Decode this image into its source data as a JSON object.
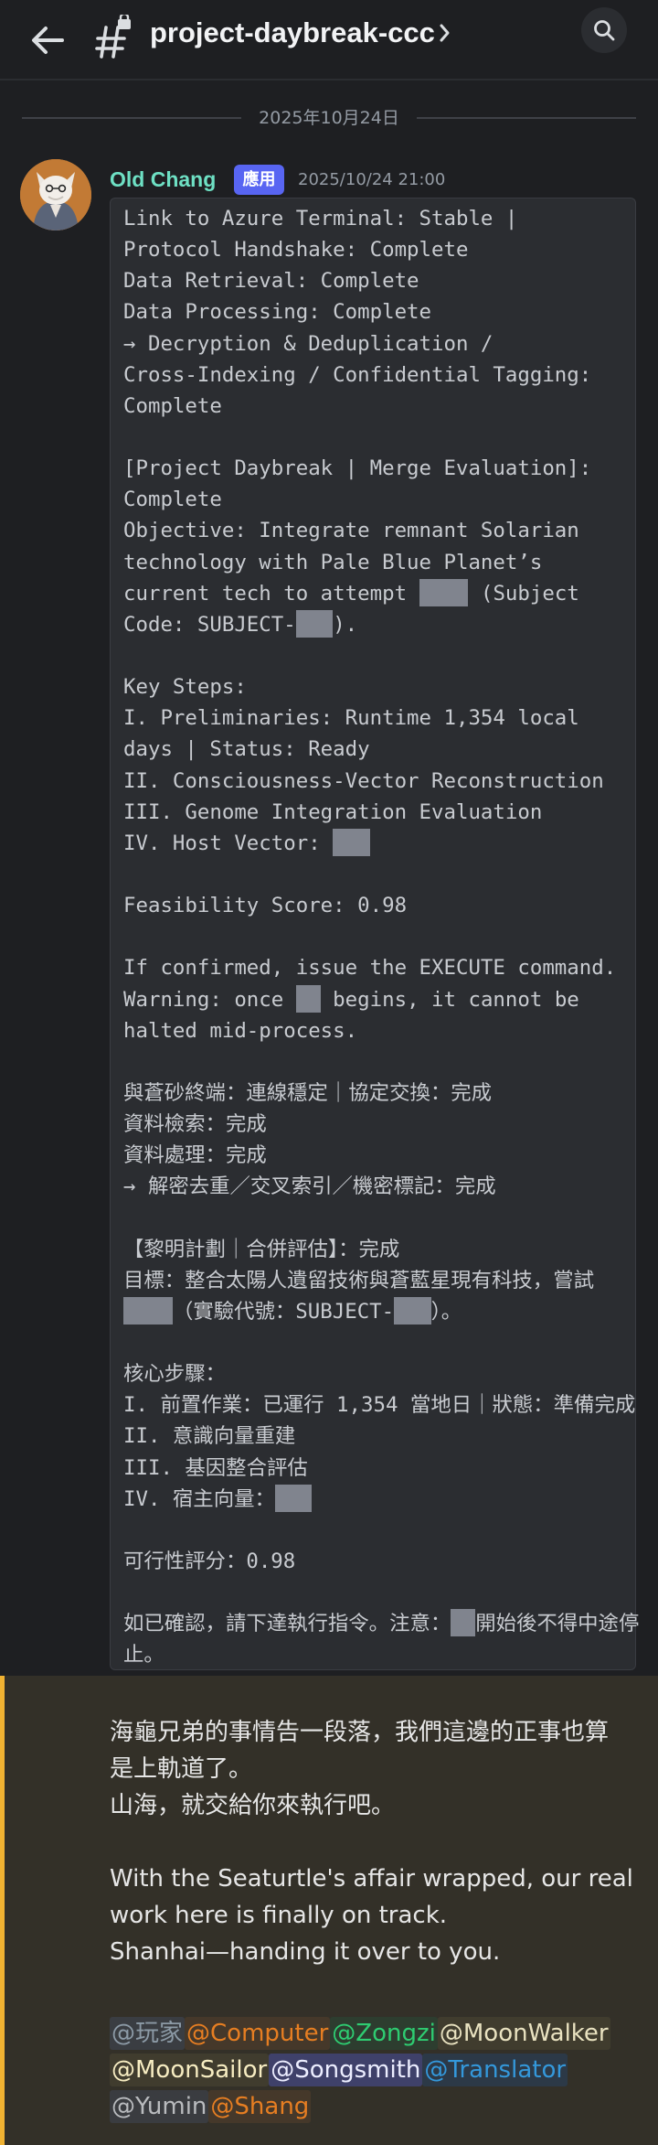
{
  "header": {
    "channel_name": "project-daybreak-ccc",
    "back_icon": "arrow-left-icon",
    "channel_icon": "locked-thread-hash-icon",
    "chevron_icon": "chevron-right-icon",
    "search_icon": "search-icon"
  },
  "date_divider": "2025年10月24日",
  "message": {
    "author": "Old Chang",
    "author_color": "#6ee0c4",
    "badge": "應用",
    "badge_color": "#5865f2",
    "timestamp": "2025/10/24 21:00",
    "code_lines": [
      "Link to Azure Terminal: Stable |",
      "Protocol Handshake: Complete",
      "Data Retrieval: Complete",
      "Data Processing: Complete",
      "→ Decryption & Deduplication /",
      "Cross-Indexing / Confidential Tagging:",
      "Complete",
      "",
      "[Project Daybreak | Merge Evaluation]:",
      "Complete",
      "Objective: Integrate remnant Solarian",
      "technology with Pale Blue Planet’s",
      [
        "current tech to attempt ",
        {
          "redact": 4
        },
        " (Subject"
      ],
      [
        "Code: SUBJECT-",
        {
          "redact": 3
        },
        ")."
      ],
      "",
      "Key Steps:",
      "I. Preliminaries: Runtime 1,354 local",
      "days | Status: Ready",
      "II. Consciousness-Vector Reconstruction",
      "III. Genome Integration Evaluation",
      [
        "IV. Host Vector: ",
        {
          "redact": 3
        }
      ],
      "",
      "Feasibility Score: 0.98",
      "",
      "If confirmed, issue the EXECUTE command.",
      [
        "Warning: once ",
        {
          "redact": 2
        },
        " begins, it cannot be"
      ],
      "halted mid-process.",
      "",
      "與蒼砂終端：連線穩定｜協定交換：完成",
      "資料檢索：完成",
      "資料處理：完成",
      "→ 解密去重／交叉索引／機密標記：完成",
      "",
      "【黎明計劃｜合併評估】：完成",
      "目標：整合太陽人遺留技術與蒼藍星現有科技，嘗試",
      [
        {
          "redact": 4
        },
        "（實驗代號：SUBJECT-",
        {
          "redact": 3
        },
        "）。"
      ],
      "",
      "核心步驟：",
      "I. 前置作業：已運行 1,354 當地日｜狀態：準備完成",
      "II. 意識向量重建",
      "III. 基因整合評估",
      [
        "IV. 宿主向量：",
        {
          "redact": 3
        }
      ],
      "",
      "可行性評分：0.98",
      "",
      [
        "如已確認，請下達執行指令。注意：",
        {
          "redact": 2
        },
        "開始後不得中途停"
      ],
      "止。"
    ]
  },
  "reply": {
    "accent_color": "#f0b232",
    "text": "海龜兄弟的事情告一段落，我們這邊的正事也算\n是上軌道了。\n山海，就交給你來執行吧。\n\nWith the Seaturtle's affair wrapped, our real\nwork here is finally on track.\nShanhai—handing it over to you.",
    "mention_rows": [
      [
        {
          "label": "@玩家",
          "color": "#8c9aa6",
          "bg": "#3a3d42"
        },
        {
          "label": "@Computer",
          "color": "#e67e22",
          "bg": "#45382a"
        },
        {
          "label": "@Zongzi",
          "color": "#2ecc71",
          "bg": "#2d3d2f"
        },
        {
          "label": "@MoonWalker",
          "color": "#e9e2c0",
          "bg": "#403c2e"
        }
      ],
      [
        {
          "label": "@MoonSailor",
          "color": "#f7edc2",
          "bg": "#403c2e"
        },
        {
          "label": "@Songsmith",
          "color": "#eceeff",
          "bg": "#3f416a"
        },
        {
          "label": "@Translator",
          "color": "#3498db",
          "bg": "#2c3947"
        }
      ],
      [
        {
          "label": "@Yumin",
          "color": "#b9bbbe",
          "bg": "#3a3c40"
        },
        {
          "label": "@Shang",
          "color": "#e67e22",
          "bg": "#45382a"
        }
      ]
    ]
  }
}
